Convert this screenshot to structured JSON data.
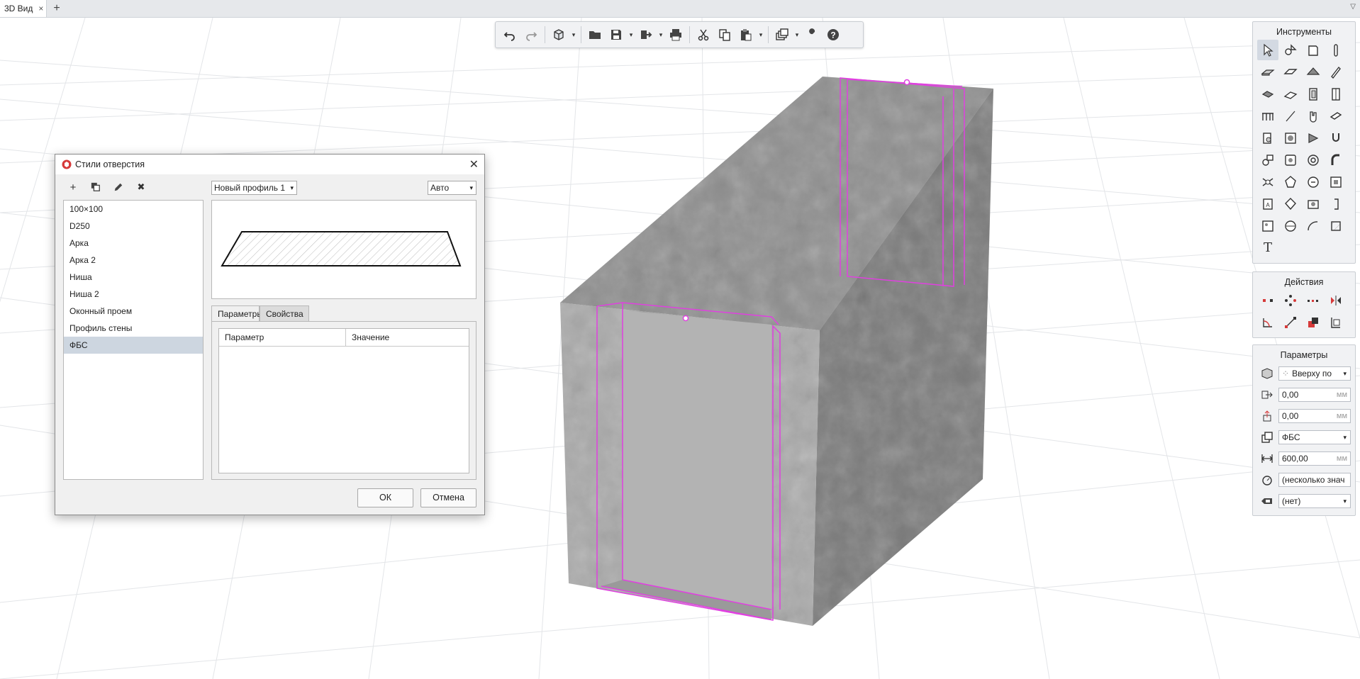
{
  "tabs": {
    "active_label": "3D Вид",
    "close_glyph": "×",
    "add_glyph": "+",
    "menu_glyph": "▽"
  },
  "toolbar": {
    "buttons": [
      "undo-icon",
      "redo-icon",
      "view-cube-icon",
      "open-folder-icon",
      "save-icon",
      "export-icon",
      "print-icon",
      "cut-icon",
      "copy-icon",
      "paste-icon",
      "layers-icon",
      "wrench-icon",
      "help-icon"
    ],
    "dropdown_glyph": "▾"
  },
  "tools_panel": {
    "title": "Инструменты",
    "text_tool_glyph": "T"
  },
  "actions_panel": {
    "title": "Действия"
  },
  "params_panel": {
    "title": "Параметры",
    "anchor_value": "Вверху по",
    "offset_x": "0,00",
    "offset_y": "0,00",
    "style_value": "ФБС",
    "depth_value": "600,00",
    "angle_value": "(несколько знач",
    "label_value": "(нет)",
    "unit": "мм",
    "arrow": "▾"
  },
  "dialog": {
    "title": "Стили отверстия",
    "close_glyph": "✕",
    "tool_add": "+",
    "tool_delete": "✖",
    "styles": [
      "100×100",
      "D250",
      "Арка",
      "Арка 2",
      "Ниша",
      "Ниша 2",
      "Оконный проем",
      "Профиль стены",
      "ФБС"
    ],
    "selected_index": 8,
    "profile_combo": "Новый профиль 1",
    "mode_combo": "Авто",
    "tab_params": "Параметры",
    "tab_props": "Свойства",
    "col_param": "Параметр",
    "col_value": "Значение",
    "ok_label": "ОК",
    "cancel_label": "Отмена"
  },
  "colors": {
    "selection": "#e040e0",
    "accent_red": "#d63a3a",
    "list_selected": "#cdd6e0"
  }
}
